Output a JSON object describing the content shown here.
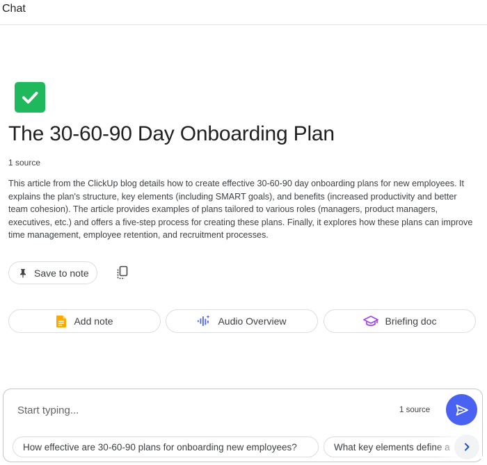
{
  "header": {
    "title": "Chat"
  },
  "notebook": {
    "emoji_icon": "check-mark-button-emoji",
    "emoji_color": "#1fb85c",
    "title": "The 30-60-90 Day Onboarding Plan",
    "source_count": "1 source",
    "summary": "This article from the ClickUp blog details how to create effective 30-60-90 day onboarding plans for new employees. It explains the plan's structure, key elements (including SMART goals), and benefits (increased productivity and better team cohesion). The article provides examples of plans tailored to various roles (managers, product managers, executives, etc.) and offers a five-step process for creating these plans. Finally, it explores how these plans can improve time management, employee retention, and recruitment processes."
  },
  "summary_actions": {
    "save_label": "Save to note",
    "save_icon": "pin-icon",
    "copy_icon": "copy-icon"
  },
  "actions": [
    {
      "label": "Add note",
      "icon": "note-icon",
      "color": "#f9ab00"
    },
    {
      "label": "Audio Overview",
      "icon": "audio-wave-icon",
      "color": "#4a62f2"
    },
    {
      "label": "Briefing doc",
      "icon": "graduation-cap-icon",
      "color": "#a142f4"
    }
  ],
  "composer": {
    "placeholder": "Start typing...",
    "source_count": "1 source",
    "send_icon": "send-icon",
    "send_color": "#4a62f2"
  },
  "suggestions": [
    "How effective are 30-60-90 plans for onboarding new employees?",
    "What key elements define a"
  ],
  "suggestions_next_icon": "chevron-right-icon"
}
